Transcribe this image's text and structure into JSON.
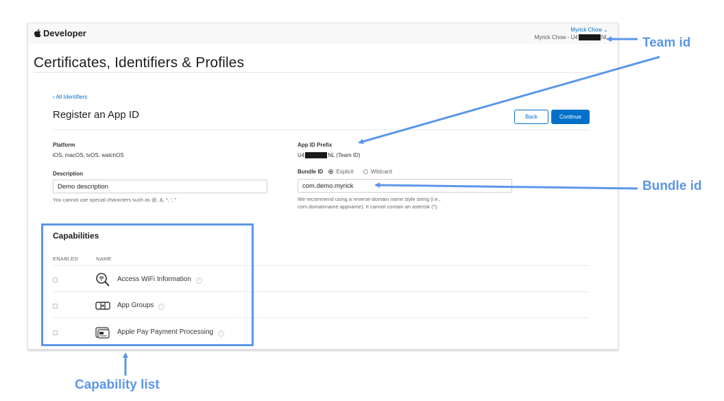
{
  "header": {
    "logo_text": "Developer",
    "account_menu": "Myrick Chow ⌄",
    "team_prefix": "Myrick Chow - U4",
    "team_suffix": "NL"
  },
  "page": {
    "title": "Certificates, Identifiers & Profiles",
    "back_link": "‹ All Identifiers",
    "subtitle": "Register an App ID",
    "back_button": "Back",
    "continue_button": "Continue"
  },
  "form": {
    "platform_label": "Platform",
    "platform_value": "iOS, macOS, tvOS, watchOS",
    "description_label": "Description",
    "description_value": "Demo description",
    "description_hint": "You cannot use special characters such as @, &, *, ', \"",
    "prefix_label": "App ID Prefix",
    "prefix_start": "U4",
    "prefix_end": "NL (Team ID)",
    "bundle_label": "Bundle ID",
    "bundle_explicit": "Explicit",
    "bundle_wildcard": "Wildcard",
    "bundle_value": "com.demo.myrick",
    "bundle_hint_1": "We recommend using a reverse-domain name style string (i.e.,",
    "bundle_hint_2": "com.domainname.appname). It cannot contain an asterisk (*)."
  },
  "capabilities": {
    "title": "Capabilities",
    "col_enabled": "ENABLED",
    "col_name": "NAME",
    "items": [
      {
        "name": "Access WiFi Information",
        "icon": "wifi-search-icon"
      },
      {
        "name": "App Groups",
        "icon": "app-groups-icon"
      },
      {
        "name": "Apple Pay Payment Processing",
        "icon": "apple-pay-card-icon"
      }
    ]
  },
  "annotations": {
    "team_id": "Team id",
    "bundle_id": "Bundle id",
    "capability_list": "Capability list",
    "color": "#5b96e8"
  },
  "colors": {
    "accent": "#0070c9",
    "redaction": "#1a1a1a"
  }
}
